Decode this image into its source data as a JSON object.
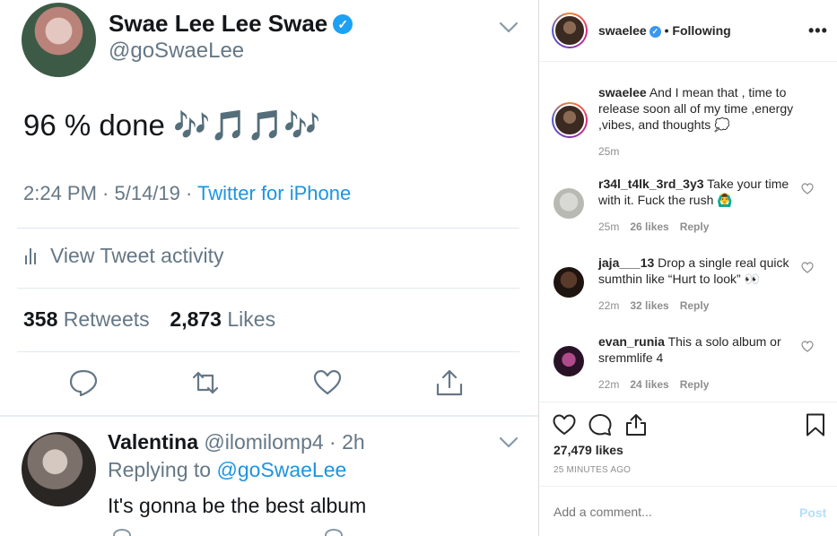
{
  "tweet": {
    "display_name": "Swae Lee Lee Swae",
    "handle": "@goSwaeLee",
    "text": "96 % done 🎶🎵🎵🎶",
    "time": "2:24 PM · 5/14/19 · ",
    "source": "Twitter for iPhone",
    "activity_label": "View Tweet activity",
    "retweets_count": "358",
    "retweets_label": " Retweets",
    "likes_count": "2,873",
    "likes_label": " Likes",
    "icons": [
      "reply-icon",
      "retweet-icon",
      "like-icon",
      "share-icon",
      "chevron-down-icon",
      "verified-icon",
      "activity-bars-icon"
    ],
    "accent": "#1b95e0"
  },
  "reply": {
    "display_name": "Valentina",
    "handle_time": " @ilomilomp4 · 2h",
    "replying_prefix": "Replying to ",
    "replying_to": "@goSwaeLee",
    "text": "It's gonna be the best album"
  },
  "instagram": {
    "header": {
      "username": "swaelee",
      "separator": " • ",
      "following": "Following",
      "more": "•••"
    },
    "caption": {
      "username": "swaelee",
      "text": " And I mean that , time to release soon all of my time ,energy ,vibes, and thoughts 💭",
      "time": "25m"
    },
    "comments": [
      {
        "username": "r34l_t4lk_3rd_3y3",
        "text": " Take your time with it. Fuck the rush 🙆‍♂️",
        "time": "25m",
        "likes": "26 likes",
        "reply": "Reply"
      },
      {
        "username": "jaja___13",
        "text": " Drop a single real quick sumthin like “Hurt to look” 👀",
        "time": "22m",
        "likes": "32 likes",
        "reply": "Reply"
      },
      {
        "username": "evan_runia",
        "text": " This a solo album or sremmlife 4",
        "time": "22m",
        "likes": "24 likes",
        "reply": "Reply"
      }
    ],
    "likes": "27,479 likes",
    "time_ago": "25 MINUTES AGO",
    "comment_placeholder": "Add a comment...",
    "post_label": "Post",
    "icons": [
      "heart-icon",
      "comment-icon",
      "share-icon",
      "bookmark-icon"
    ],
    "post_color": "#b2dffc"
  }
}
